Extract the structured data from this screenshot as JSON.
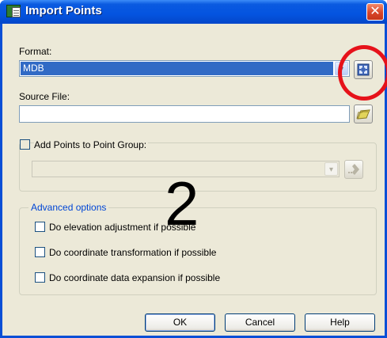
{
  "window": {
    "title": "Import Points",
    "close_glyph": "✕"
  },
  "format": {
    "label": "Format:",
    "selected": "MDB",
    "arrow_glyph": "▾",
    "options_icon": "settings-icon"
  },
  "source_file": {
    "label": "Source File:",
    "value": "",
    "browse_icon": "folder-icon"
  },
  "point_group": {
    "checkbox_label": "Add Points to Point Group:",
    "checked": false,
    "selected": "",
    "arrow_glyph": "▾",
    "create_icon": "add-group-icon"
  },
  "advanced": {
    "legend": "Advanced options",
    "options": [
      {
        "label": "Do elevation adjustment if possible",
        "checked": false
      },
      {
        "label": "Do coordinate transformation if possible",
        "checked": false
      },
      {
        "label": "Do coordinate data expansion if possible",
        "checked": false
      }
    ]
  },
  "annotation": {
    "number": "2",
    "circle_color": "#e6121a"
  },
  "buttons": {
    "ok": "OK",
    "cancel": "Cancel",
    "help": "Help"
  },
  "colors": {
    "titlebar": "#0454e0",
    "selection": "#316ac5",
    "group_legend": "#0046d5"
  }
}
